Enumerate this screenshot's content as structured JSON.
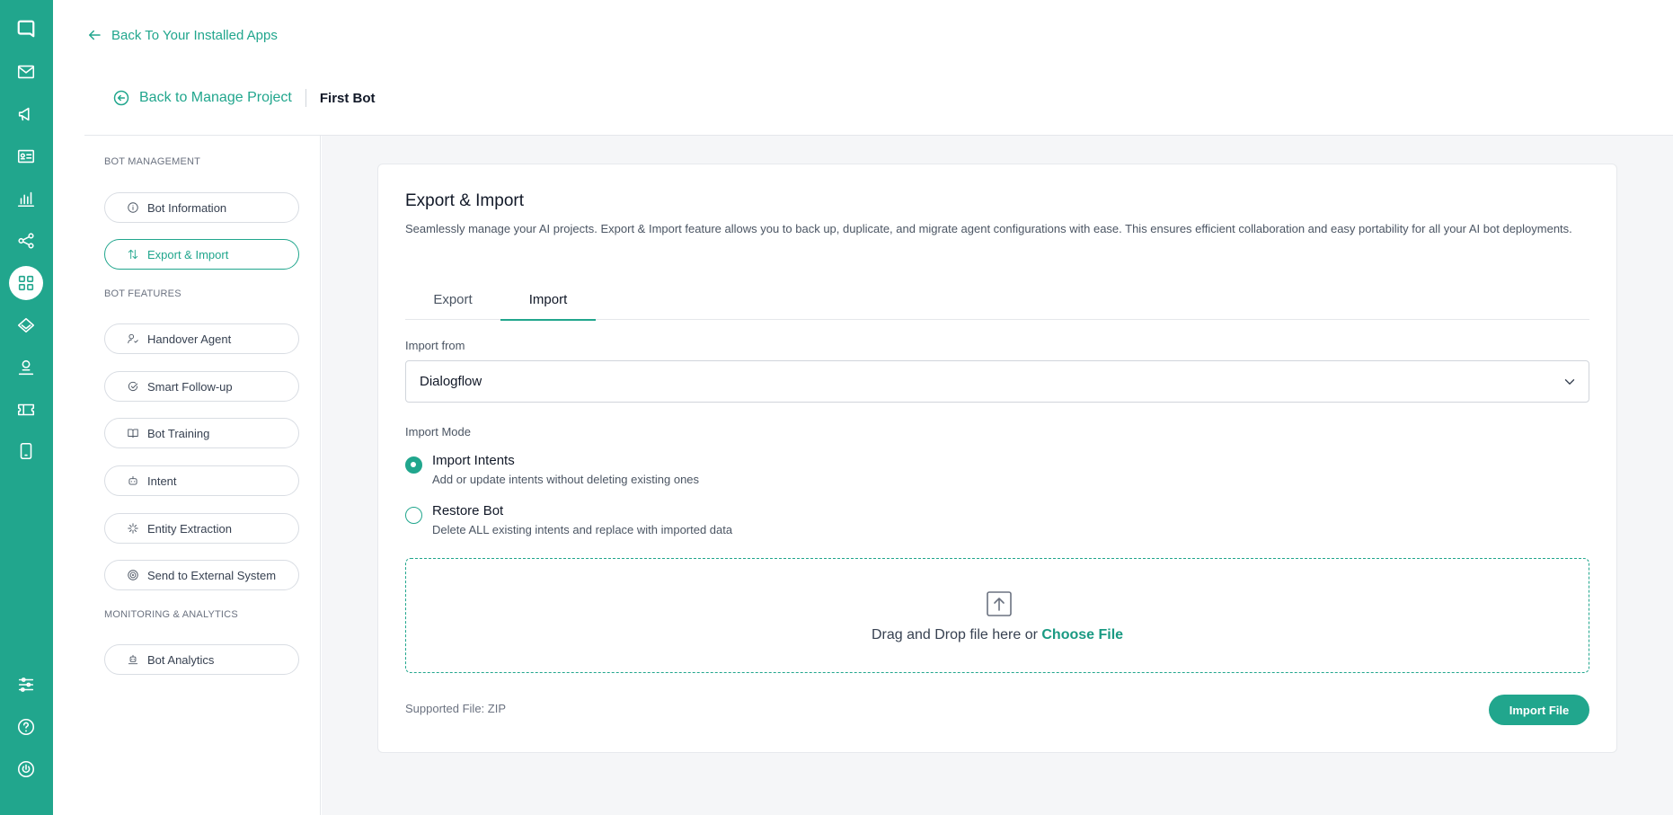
{
  "header": {
    "back_apps": "Back To Your Installed Apps",
    "back_project": "Back to Manage Project",
    "current": "First Bot"
  },
  "rail": {
    "icons": [
      "app-logo-icon",
      "mail-icon",
      "megaphone-icon",
      "contact-card-icon",
      "analytics-icon",
      "share-icon",
      "apps-grid-icon",
      "layers-icon",
      "user-icon",
      "ticket-icon",
      "mobile-icon",
      "settings-sliders-icon",
      "help-icon",
      "power-icon"
    ],
    "active": "apps-grid-icon",
    "color": "#21a68d"
  },
  "sidebar": {
    "sections": [
      {
        "title": "BOT MANAGEMENT",
        "items": [
          {
            "label": "Bot Information",
            "icon": "info-icon"
          },
          {
            "label": "Export & Import",
            "icon": "transfer-icon",
            "active": true
          }
        ]
      },
      {
        "title": "BOT FEATURES",
        "items": [
          {
            "label": "Handover Agent",
            "icon": "user-check-icon"
          },
          {
            "label": "Smart Follow-up",
            "icon": "follow-up-icon"
          },
          {
            "label": "Bot Training",
            "icon": "book-icon"
          },
          {
            "label": "Intent",
            "icon": "robot-icon"
          },
          {
            "label": "Entity Extraction",
            "icon": "sparkle-icon"
          },
          {
            "label": "Send to External System",
            "icon": "target-icon"
          }
        ]
      },
      {
        "title": "MONITORING & ANALYTICS",
        "items": [
          {
            "label": "Bot Analytics",
            "icon": "bot-analytics-icon"
          }
        ]
      }
    ]
  },
  "card": {
    "title": "Export & Import",
    "description": "Seamlessly manage your AI projects. Export & Import feature allows you to back up, duplicate, and migrate agent configurations with ease. This ensures efficient collaboration and easy portability for all your AI bot deployments.",
    "tabs": [
      {
        "label": "Export",
        "active": false
      },
      {
        "label": "Import",
        "active": true
      }
    ],
    "import_from": {
      "label": "Import from",
      "selected": "Dialogflow"
    },
    "import_mode": {
      "label": "Import Mode",
      "options": [
        {
          "title": "Import Intents",
          "subtitle": "Add or update intents without deleting existing ones",
          "selected": true
        },
        {
          "title": "Restore Bot",
          "subtitle": "Delete ALL existing intents and replace with imported data",
          "selected": false
        }
      ]
    },
    "dropzone": {
      "text": "Drag and Drop file here or",
      "link": "Choose File"
    },
    "supported": "Supported File: ZIP",
    "button": "Import File"
  }
}
